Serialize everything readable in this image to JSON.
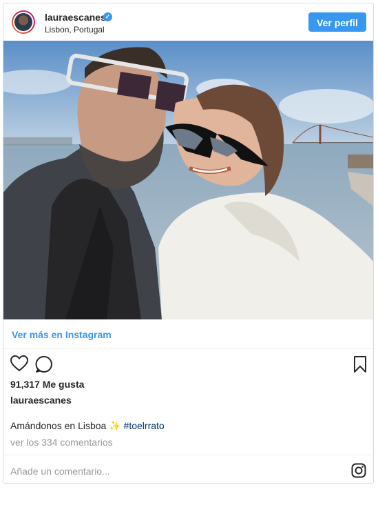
{
  "post": {
    "username": "lauraescanes",
    "location": "Lisbon, Portugal",
    "follow_label": "Ver perfil",
    "view_more_label": "Ver más en Instagram",
    "likes_text": "91,317 Me gusta",
    "caption_user": "lauraescanes",
    "caption_text": "Amándonos en Lisboa ✨",
    "hashtag": "#toelrrato",
    "comments_link": "ver los 334 comentarios",
    "comment_placeholder": "Añade un comentario..."
  },
  "colors": {
    "accent": "#3897f0",
    "hashtag": "#003569",
    "muted": "#999999",
    "border": "#dbdbdb"
  },
  "icons": [
    "heart-icon",
    "comment-icon",
    "bookmark-icon",
    "instagram-logo-icon",
    "verified-badge-icon"
  ]
}
